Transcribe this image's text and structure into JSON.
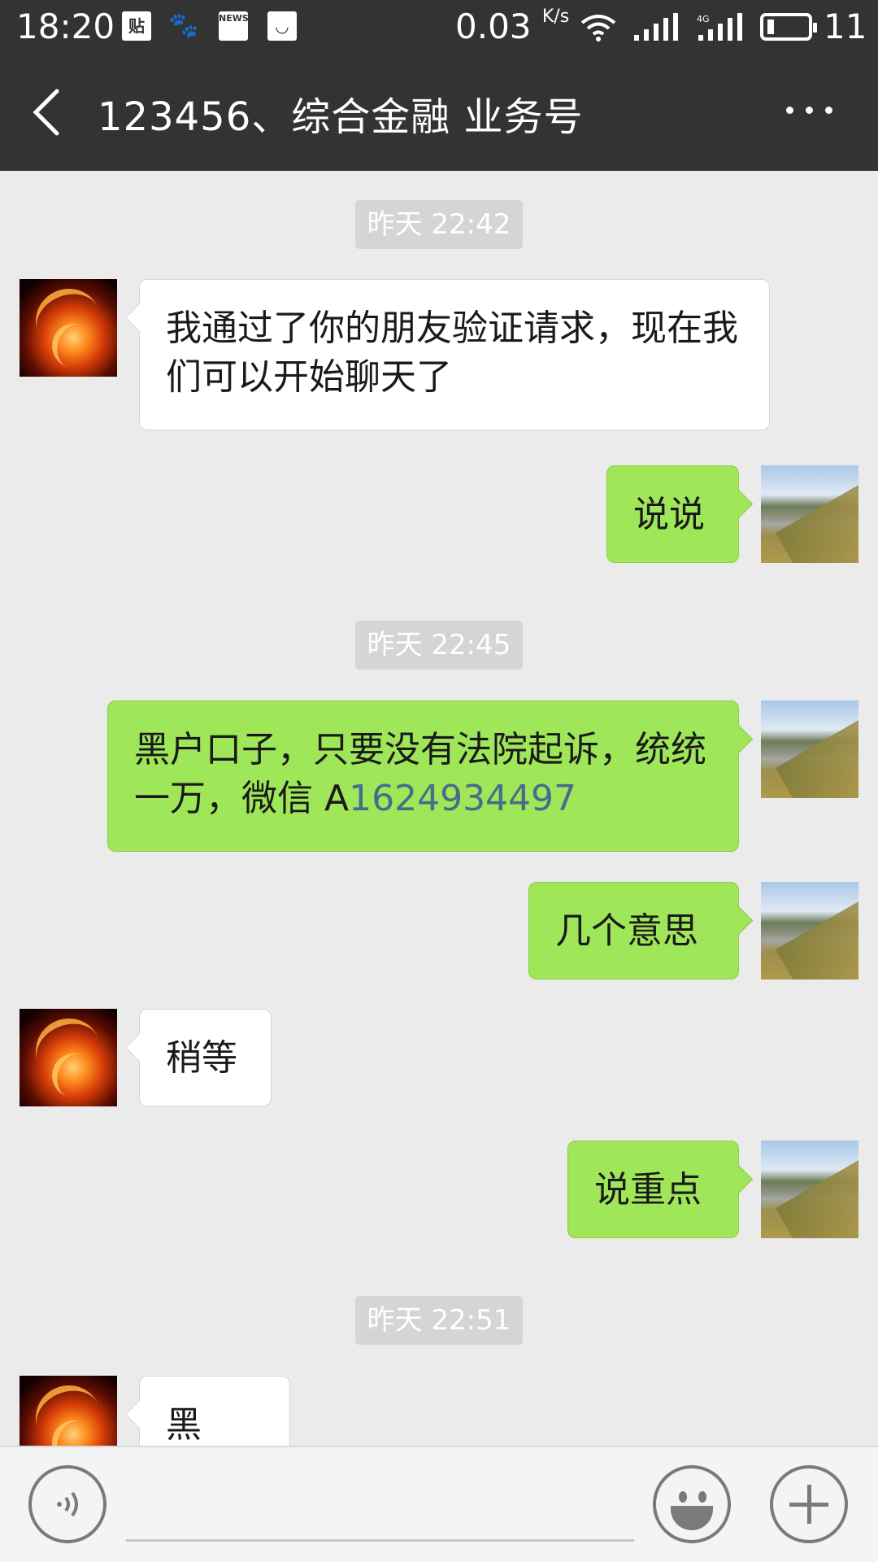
{
  "status_bar": {
    "time": "18:20",
    "app_icons": [
      {
        "name": "tieba-icon",
        "glyph": "贴"
      },
      {
        "name": "baidu-paw-icon",
        "glyph": "🐾"
      },
      {
        "name": "news-icon",
        "glyph": "NEWS"
      },
      {
        "name": "shopping-bag-icon",
        "glyph": "◡"
      }
    ],
    "speed_value": "0.03",
    "speed_unit": "K/s",
    "network_label": "4G",
    "battery_level": "11"
  },
  "header": {
    "title": "123456、综合金融 业务号"
  },
  "messages": [
    {
      "type": "time",
      "text": "昨天 22:42"
    },
    {
      "type": "msg",
      "side": "left",
      "text": "我通过了你的朋友验证请求，现在我们可以开始聊天了"
    },
    {
      "type": "msg",
      "side": "right",
      "text": "说说"
    },
    {
      "type": "time",
      "text": "昨天 22:45"
    },
    {
      "type": "msg",
      "side": "right",
      "text_prefix": "黑户口子，只要没有法院起诉，统统一万，微信 A",
      "link": "1624934497"
    },
    {
      "type": "msg",
      "side": "right",
      "text": "几个意思"
    },
    {
      "type": "msg",
      "side": "left",
      "text": "稍等"
    },
    {
      "type": "msg",
      "side": "right",
      "text": "说重点"
    },
    {
      "type": "time",
      "text": "昨天 22:51"
    },
    {
      "type": "msg",
      "side": "left",
      "text": "黑户？"
    }
  ],
  "input": {
    "value": "",
    "placeholder": ""
  },
  "colors": {
    "bar_bg": "#333333",
    "chat_bg": "#ebebeb",
    "sent_bubble": "#9fe658",
    "received_bubble": "#ffffff",
    "link": "#4b6b8a"
  }
}
